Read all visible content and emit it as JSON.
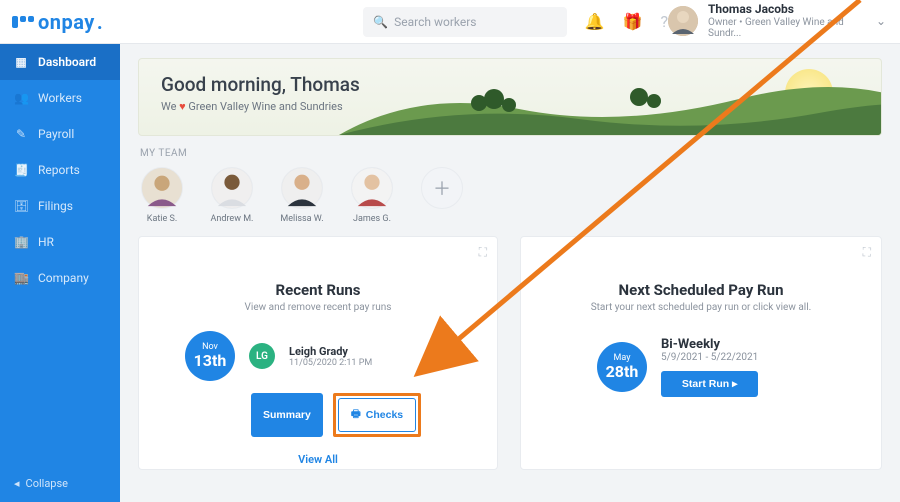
{
  "topbar": {
    "logo_text": "onpay",
    "search_placeholder": "Search workers",
    "user_name": "Thomas Jacobs",
    "user_role": "Owner • Green Valley Wine and Sundr..."
  },
  "sidebar": {
    "items": [
      {
        "label": "Dashboard",
        "icon": "▦"
      },
      {
        "label": "Workers",
        "icon": "👥"
      },
      {
        "label": "Payroll",
        "icon": "✎"
      },
      {
        "label": "Reports",
        "icon": "📄"
      },
      {
        "label": "Filings",
        "icon": "🗄"
      },
      {
        "label": "HR",
        "icon": "🏢"
      },
      {
        "label": "Company",
        "icon": "🏬"
      }
    ],
    "collapse_label": "Collapse"
  },
  "banner": {
    "title": "Good morning, Thomas",
    "subtitle_prefix": "We ",
    "subtitle_suffix": " Green Valley Wine and Sundries"
  },
  "team": {
    "label": "MY TEAM",
    "members": [
      {
        "name": "Katie S."
      },
      {
        "name": "Andrew M."
      },
      {
        "name": "Melissa W."
      },
      {
        "name": "James G."
      }
    ]
  },
  "recent_runs": {
    "title": "Recent Runs",
    "subtitle": "View and remove recent pay runs",
    "date_month": "Nov",
    "date_day": "13th",
    "initials": "LG",
    "runner_name": "Leigh Grady",
    "timestamp": "11/05/2020 2:11 PM",
    "summary_label": "Summary",
    "checks_label": "Checks",
    "view_all_label": "View All"
  },
  "next_run": {
    "title": "Next Scheduled Pay Run",
    "subtitle": "Start your next scheduled pay run or click view all.",
    "date_month": "May",
    "date_day": "28th",
    "schedule_name": "Bi-Weekly",
    "range": "5/9/2021 - 5/22/2021",
    "start_label": "Start Run ▸"
  }
}
